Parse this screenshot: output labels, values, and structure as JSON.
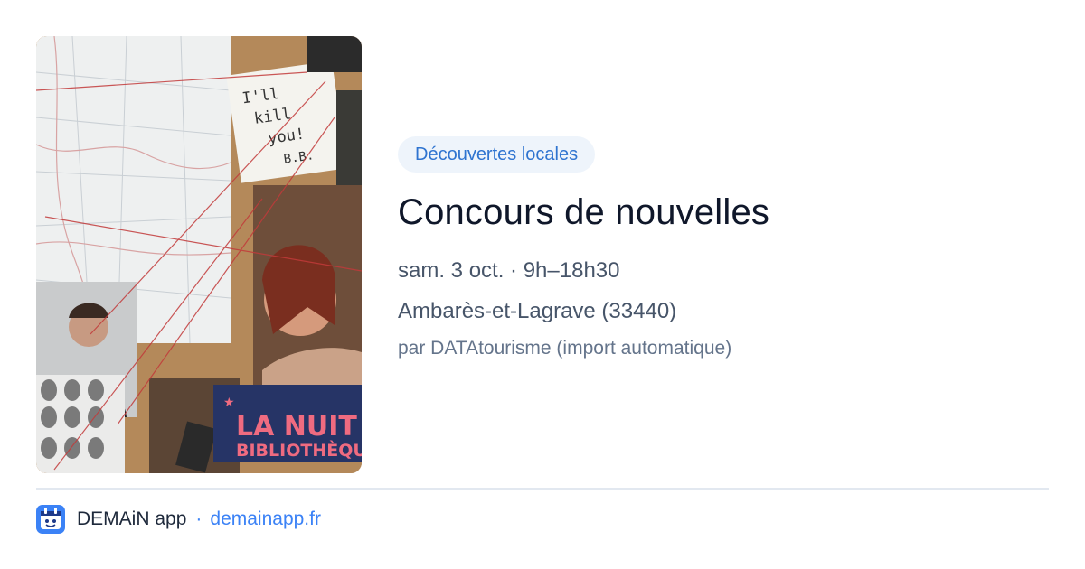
{
  "event": {
    "category": "Découvertes locales",
    "title": "Concours de nouvelles",
    "datetime": "sam. 3 oct. · 9h–18h30",
    "location": "Ambarès-et-Lagrave (33440)",
    "source": "par DATAtourisme (import automatique)"
  },
  "image": {
    "note_text": [
      "I'll",
      "kill",
      "you!",
      "B.B."
    ],
    "poster_line1": "LA NUIT",
    "poster_line2": "BIBLIOTHÈQU"
  },
  "footer": {
    "app_name": "DEMAiN app",
    "separator": "·",
    "domain": "demainapp.fr"
  },
  "colors": {
    "accent": "#3b82f6",
    "badge_bg": "#eef4fb",
    "badge_text": "#2f74d0"
  }
}
